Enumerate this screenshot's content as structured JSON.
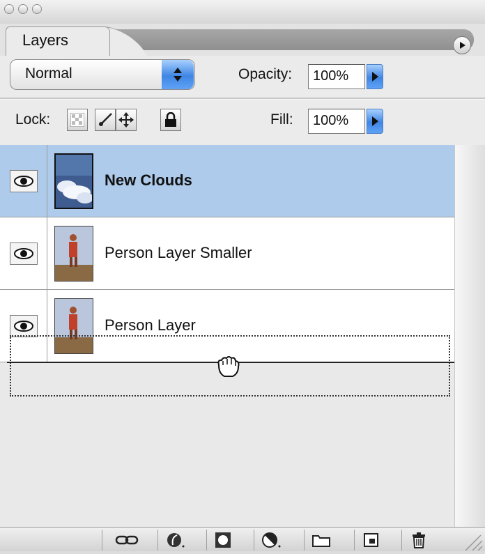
{
  "panel": {
    "tab_label": "Layers"
  },
  "blend": {
    "mode": "Normal"
  },
  "opacity": {
    "label": "Opacity:",
    "value": "100%"
  },
  "lock": {
    "label": "Lock:"
  },
  "fill": {
    "label": "Fill:",
    "value": "100%"
  },
  "layers": [
    {
      "name": "New Clouds",
      "visible": true,
      "selected": true,
      "thumb": "clouds"
    },
    {
      "name": "Person Layer Smaller",
      "visible": true,
      "selected": false,
      "thumb": "person"
    },
    {
      "name": "Person Layer",
      "visible": true,
      "selected": false,
      "thumb": "person"
    }
  ],
  "colors": {
    "selection": "#aecbeb",
    "accent_blue": "#3f86e4"
  },
  "toolbar_icons": [
    "link-icon",
    "layer-style-icon",
    "layer-mask-icon",
    "adjustment-layer-icon",
    "folder-icon",
    "new-layer-icon",
    "trash-icon"
  ]
}
